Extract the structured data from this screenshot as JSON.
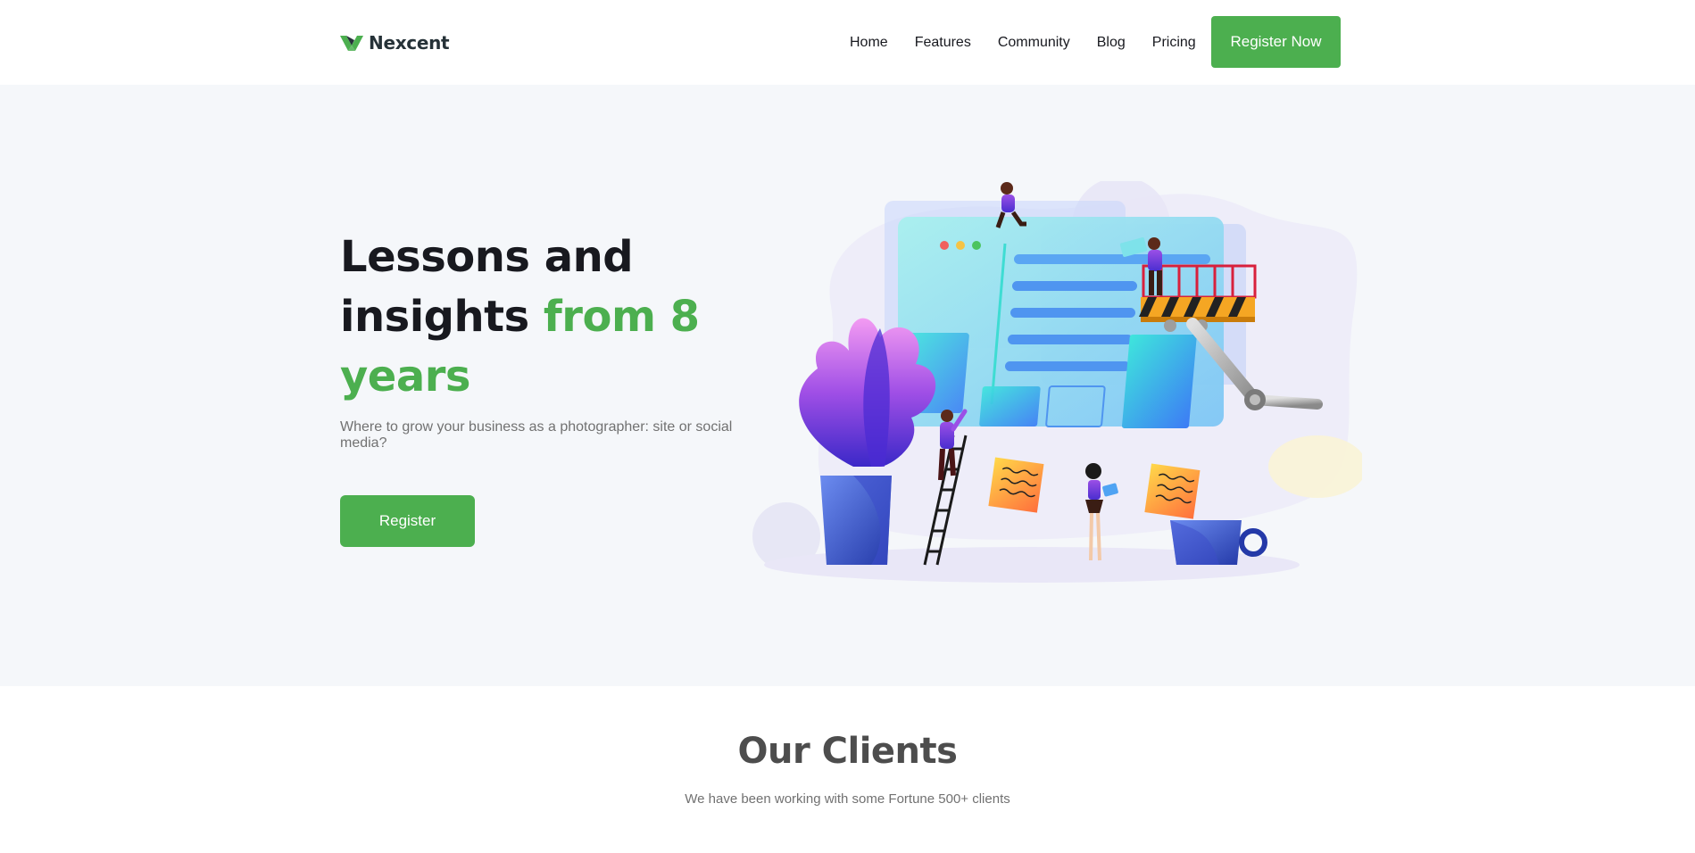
{
  "header": {
    "brand": "Nexcent",
    "nav": [
      {
        "label": "Home"
      },
      {
        "label": "Features"
      },
      {
        "label": "Community"
      },
      {
        "label": "Blog"
      },
      {
        "label": "Pricing"
      }
    ],
    "cta_label": "Register Now"
  },
  "hero": {
    "title_part1": "Lessons and insights ",
    "title_accent": "from 8 years",
    "subtitle": "Where to grow your business as a photographer: site or social media?",
    "button_label": "Register"
  },
  "clients": {
    "title": "Our Clients",
    "subtitle": "We have been working with some Fortune 500+ clients"
  },
  "colors": {
    "brand_green": "#4caf4f",
    "hero_background": "#f5f7fa",
    "heading_dark": "#18191f",
    "body_gray": "#717171"
  },
  "icons": {
    "logo": "nexcent-logo-icon",
    "illustration": "web-team-illustration"
  }
}
